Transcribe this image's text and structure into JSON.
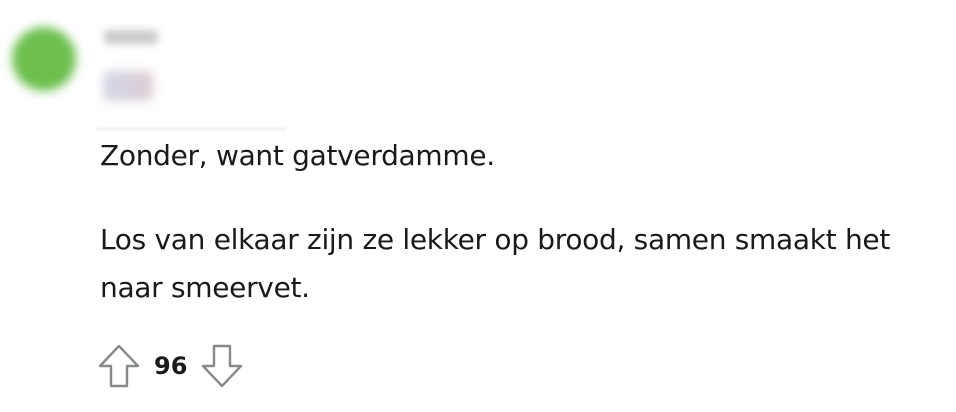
{
  "comment": {
    "paragraphs": [
      "Zonder, want gatverdamme.",
      "Los van elkaar zijn ze lekker op brood, samen smaakt het naar smeervet."
    ]
  },
  "votes": {
    "score": "96",
    "upvote_icon": "arrow-up-outline",
    "downvote_icon": "arrow-down-outline"
  },
  "colors": {
    "avatar": "#6cbf4f",
    "text": "#1a1a1b",
    "icon_stroke": "#878a8c"
  }
}
